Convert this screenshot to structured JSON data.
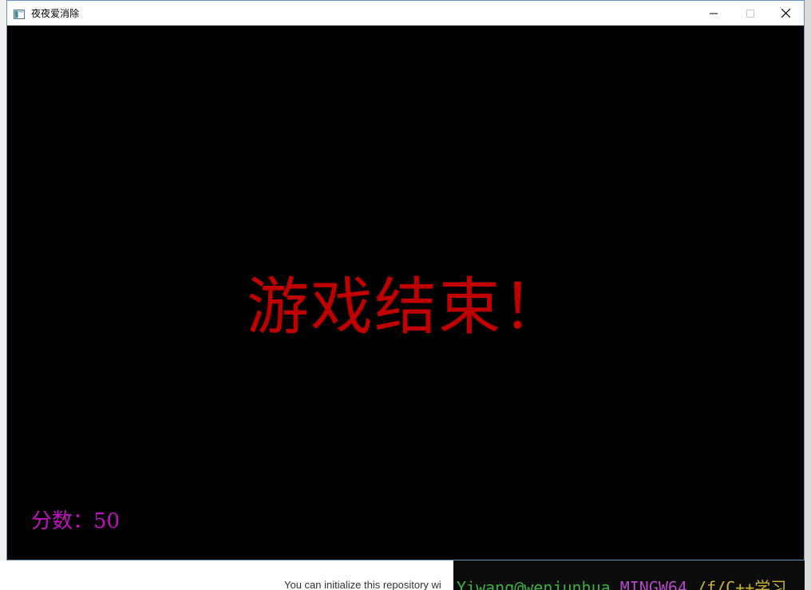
{
  "window": {
    "title": "夜夜爱消除",
    "controls": {
      "minimize_icon": "minimize-icon",
      "maximize_icon": "maximize-icon",
      "close_icon": "close-icon"
    }
  },
  "game": {
    "message": "游戏结束！",
    "score_label": "分数：",
    "score_value": "50",
    "colors": {
      "background": "#000000",
      "message": "#c00000",
      "score": "#c010c0"
    }
  },
  "background_apps": {
    "repo_hint": "You can initialize this repository wi",
    "terminal_user": "Yiwang@wenjunhua",
    "terminal_env": "MINGW64",
    "terminal_path": "/f/C++学习"
  }
}
